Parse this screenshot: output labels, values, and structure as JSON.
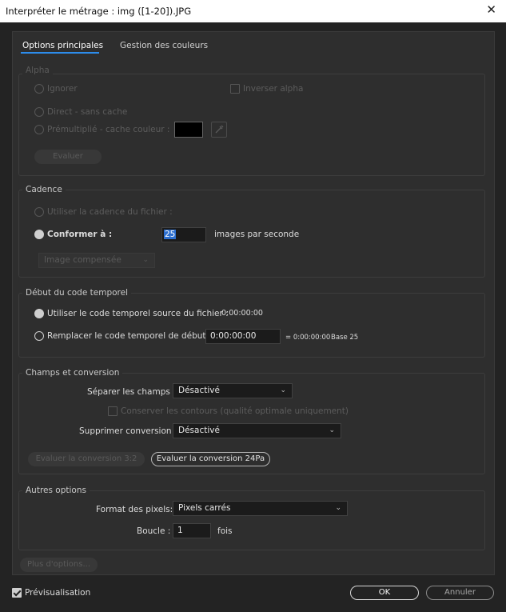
{
  "window": {
    "title": "Interpréter le métrage : img ([1-20]).JPG",
    "close_glyph": "✕"
  },
  "tabs": [
    {
      "label": "Options principales",
      "active": true
    },
    {
      "label": "Gestion des couleurs",
      "active": false
    }
  ],
  "alpha": {
    "legend": "Alpha",
    "ignore_label": "Ignorer",
    "invert_label": "Inverser alpha",
    "direct_label": "Direct - sans cache",
    "premult_label": "Prémultiplié - cache couleur :",
    "matte_color": "#000000",
    "evaluate_label": "Evaluer"
  },
  "frame_rate": {
    "legend": "Cadence",
    "use_file_label": "Utiliser la cadence du fichier :",
    "conform_label": "Conformer à :",
    "conform_value": "25",
    "fps_label": "images par seconde",
    "blend_select": "Image compensée"
  },
  "timecode": {
    "legend": "Début du code temporel",
    "use_source_label": "Utiliser le code temporel source du fichier :",
    "source_value": "0:00:00:00",
    "override_label": "Remplacer le code temporel de début :",
    "override_value": "0:00:00:00",
    "equals_text": "= 0:00:00:00",
    "base_text": "Base 25"
  },
  "fields": {
    "legend": "Champs et conversion",
    "separate_label": "Séparer les champs :",
    "separate_value": "Désactivé",
    "preserve_label": "Conserver les contours (qualité optimale uniquement)",
    "remove_pulldown_label": "Supprimer conversion :",
    "remove_pulldown_value": "Désactivé",
    "guess32_label": "Evaluer la conversion 3:2",
    "guess24pa_label": "Evaluer la conversion 24Pa"
  },
  "other": {
    "legend": "Autres options",
    "pixel_aspect_label": "Format des pixels:",
    "pixel_aspect_value": "Pixels carrés",
    "loop_label": "Boucle :",
    "loop_value": "1",
    "times_label": "fois"
  },
  "footer": {
    "more_options_label": "Plus d'options...",
    "preview_label": "Prévisualisation",
    "preview_checked": true,
    "ok_label": "OK",
    "cancel_label": "Annuler"
  }
}
